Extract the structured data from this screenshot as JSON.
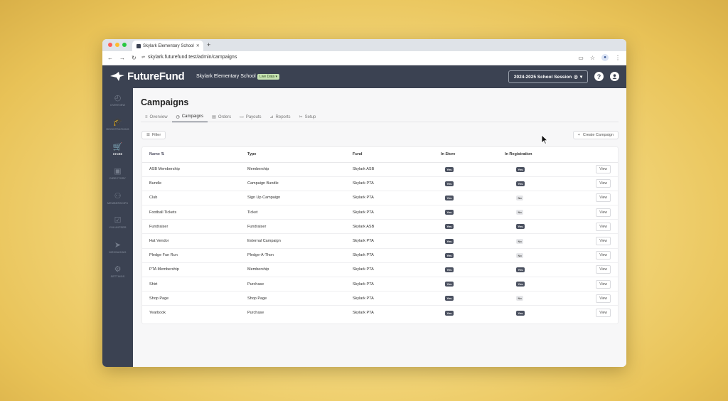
{
  "browser": {
    "tab_title": "Skylark Elementary School",
    "url": "skylark.futurefund.test/admin/campaigns",
    "traffic_lights": [
      "#ff5f57",
      "#febc2e",
      "#28c840"
    ]
  },
  "app": {
    "logo_text": "FutureFund",
    "school_name": "Skylark Elementary School",
    "live_badge": "Live Data",
    "session": "2024-2025 School Session",
    "help": "?"
  },
  "sidebar": {
    "items": [
      {
        "label": "OVERVIEW",
        "icon": "gauge-icon",
        "glyph": "◴",
        "active": false
      },
      {
        "label": "REGISTRATIONS",
        "icon": "graduation-cap-icon",
        "glyph": "🎓",
        "active": false
      },
      {
        "label": "STORE",
        "icon": "cart-icon",
        "glyph": "🛒",
        "active": true
      },
      {
        "label": "DIRECTORY",
        "icon": "contact-card-icon",
        "glyph": "▣",
        "active": false
      },
      {
        "label": "MEMBERSHIPS",
        "icon": "people-icon",
        "glyph": "⚇",
        "active": false
      },
      {
        "label": "VOLUNTEER",
        "icon": "checkbox-icon",
        "glyph": "☑",
        "active": false
      },
      {
        "label": "MESSAGING",
        "icon": "paper-plane-icon",
        "glyph": "➤",
        "active": false
      },
      {
        "label": "SETTINGS",
        "icon": "gear-icon",
        "glyph": "⚙",
        "active": false
      }
    ]
  },
  "main": {
    "title": "Campaigns",
    "tabs": [
      {
        "label": "Overview",
        "glyph": "≡",
        "active": false
      },
      {
        "label": "Campaigns",
        "glyph": "◷",
        "active": true
      },
      {
        "label": "Orders",
        "glyph": "▤",
        "active": false
      },
      {
        "label": "Payouts",
        "glyph": "▭",
        "active": false
      },
      {
        "label": "Reports",
        "glyph": "⊿",
        "active": false
      },
      {
        "label": "Setup",
        "glyph": "✂",
        "active": false
      }
    ],
    "filter_label": "Filter",
    "create_label": "Create Campaign"
  },
  "table": {
    "headers": {
      "name": "Name",
      "type": "Type",
      "fund": "Fund",
      "in_store": "In Store",
      "in_registration": "In Registration"
    },
    "view_label": "View",
    "rows": [
      {
        "name": "ASB Membership",
        "type": "Membership",
        "fund": "Skylark ASB",
        "in_store": "Yes",
        "in_registration": "Yes"
      },
      {
        "name": "Bundle",
        "type": "Campaign Bundle",
        "fund": "Skylark PTA",
        "in_store": "Yes",
        "in_registration": "Yes"
      },
      {
        "name": "Club",
        "type": "Sign Up Campaign",
        "fund": "Skylark PTA",
        "in_store": "Yes",
        "in_registration": "No"
      },
      {
        "name": "Football Tickets",
        "type": "Ticket",
        "fund": "Skylark PTA",
        "in_store": "Yes",
        "in_registration": "No"
      },
      {
        "name": "Fundraiser",
        "type": "Fundraiser",
        "fund": "Skylark ASB",
        "in_store": "Yes",
        "in_registration": "Yes"
      },
      {
        "name": "Hat Vendor",
        "type": "External Campaign",
        "fund": "Skylark PTA",
        "in_store": "Yes",
        "in_registration": "No"
      },
      {
        "name": "Pledge Fun Run",
        "type": "Pledge-A-Thon",
        "fund": "Skylark PTA",
        "in_store": "Yes",
        "in_registration": "No"
      },
      {
        "name": "PTA Membership",
        "type": "Membership",
        "fund": "Skylark PTA",
        "in_store": "Yes",
        "in_registration": "Yes"
      },
      {
        "name": "Shirt",
        "type": "Purchase",
        "fund": "Skylark PTA",
        "in_store": "Yes",
        "in_registration": "Yes"
      },
      {
        "name": "Shop Page",
        "type": "Shop Page",
        "fund": "Skylark PTA",
        "in_store": "Yes",
        "in_registration": "No"
      },
      {
        "name": "Yearbook",
        "type": "Purchase",
        "fund": "Skylark PTA",
        "in_store": "Yes",
        "in_registration": "Yes"
      }
    ]
  }
}
